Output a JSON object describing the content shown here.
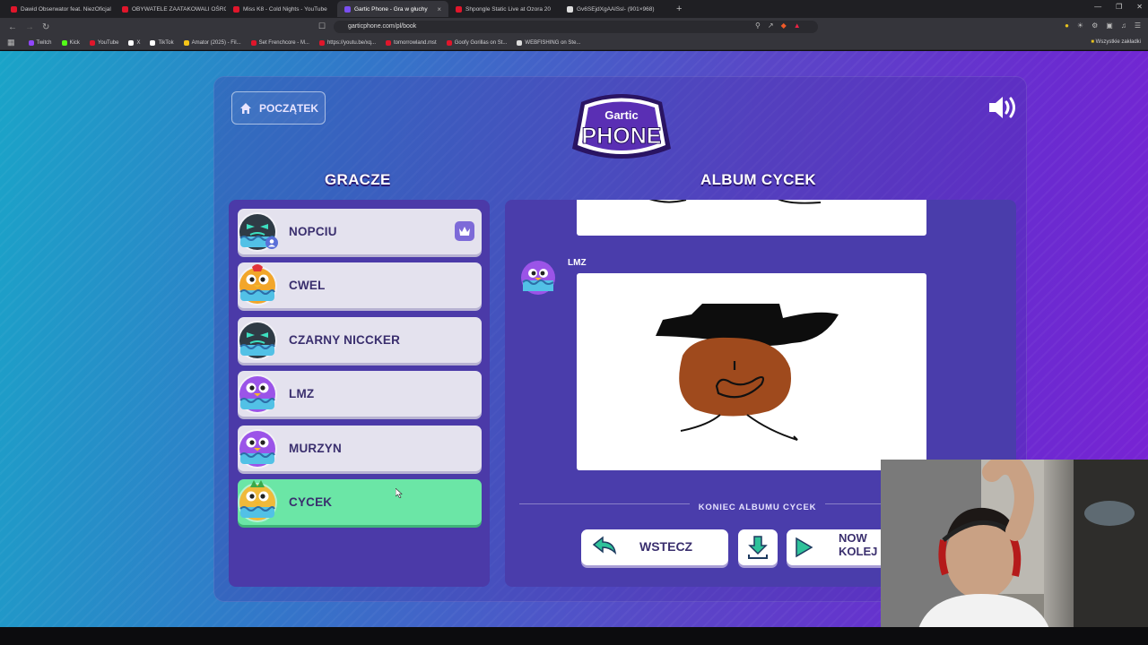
{
  "browser": {
    "tabs": [
      {
        "label": "Dawid Obserwator feat. NiezOficjal",
        "color": "#e0162b"
      },
      {
        "label": "OBYWATELE ZAATAKOWALI OŚRODE",
        "color": "#e0162b"
      },
      {
        "label": "Miss K8 - Cold Nights - YouTube",
        "color": "#e0162b"
      },
      {
        "label": "Gartic Phone - Gra w głuchy",
        "color": "#7a4ff0",
        "active": true
      },
      {
        "label": "Shpongle Static Live at Ozora 20",
        "color": "#e0162b"
      },
      {
        "label": "Gv6SEjdXgAAlSsl- (901×968)",
        "color": "#dddddd"
      }
    ],
    "new_tab": "+",
    "url": "garticphone.com/pl/book",
    "bookmarks": [
      {
        "label": "Twitch",
        "color": "#9146ff"
      },
      {
        "label": "Kick",
        "color": "#53fc18"
      },
      {
        "label": "YouTube",
        "color": "#e0162b"
      },
      {
        "label": "X",
        "color": "#ffffff"
      },
      {
        "label": "TikTok",
        "color": "#ffffff"
      },
      {
        "label": "Amator (2025) - Fil...",
        "color": "#f5c518"
      },
      {
        "label": "Set Frenchcore - M...",
        "color": "#e0162b"
      },
      {
        "label": "https://youtu.be/xq...",
        "color": "#e0162b"
      },
      {
        "label": "tomorrowland.mst",
        "color": "#e0162b"
      },
      {
        "label": "Goofy Gorillas on St...",
        "color": "#e0162b"
      },
      {
        "label": "WEBFISHING on Ste...",
        "color": "#dddddd"
      }
    ],
    "all_bookmarks": "Wszystkie zakładki"
  },
  "game": {
    "home_label": "POCZĄTEK",
    "logo_top": "Gartic",
    "logo_bottom": "PHONE",
    "players_heading": "GRACZE",
    "album_heading": "ALBUM CYCEK",
    "players": [
      {
        "name": "NOPCIU",
        "avatar": "green",
        "host": true
      },
      {
        "name": "CWEL",
        "avatar": "orange"
      },
      {
        "name": "CZARNY NICCKER",
        "avatar": "green"
      },
      {
        "name": "LMZ",
        "avatar": "purple"
      },
      {
        "name": "MURZYN",
        "avatar": "purple"
      },
      {
        "name": "CYCEK",
        "avatar": "pineapple",
        "active": true
      }
    ],
    "album": {
      "author": "LMZ",
      "end_label": "KONIEC ALBUMU CYCEK"
    },
    "buttons": {
      "back": "WSTECZ",
      "next_line1": "NOW",
      "next_line2": "KOLEJ"
    }
  }
}
